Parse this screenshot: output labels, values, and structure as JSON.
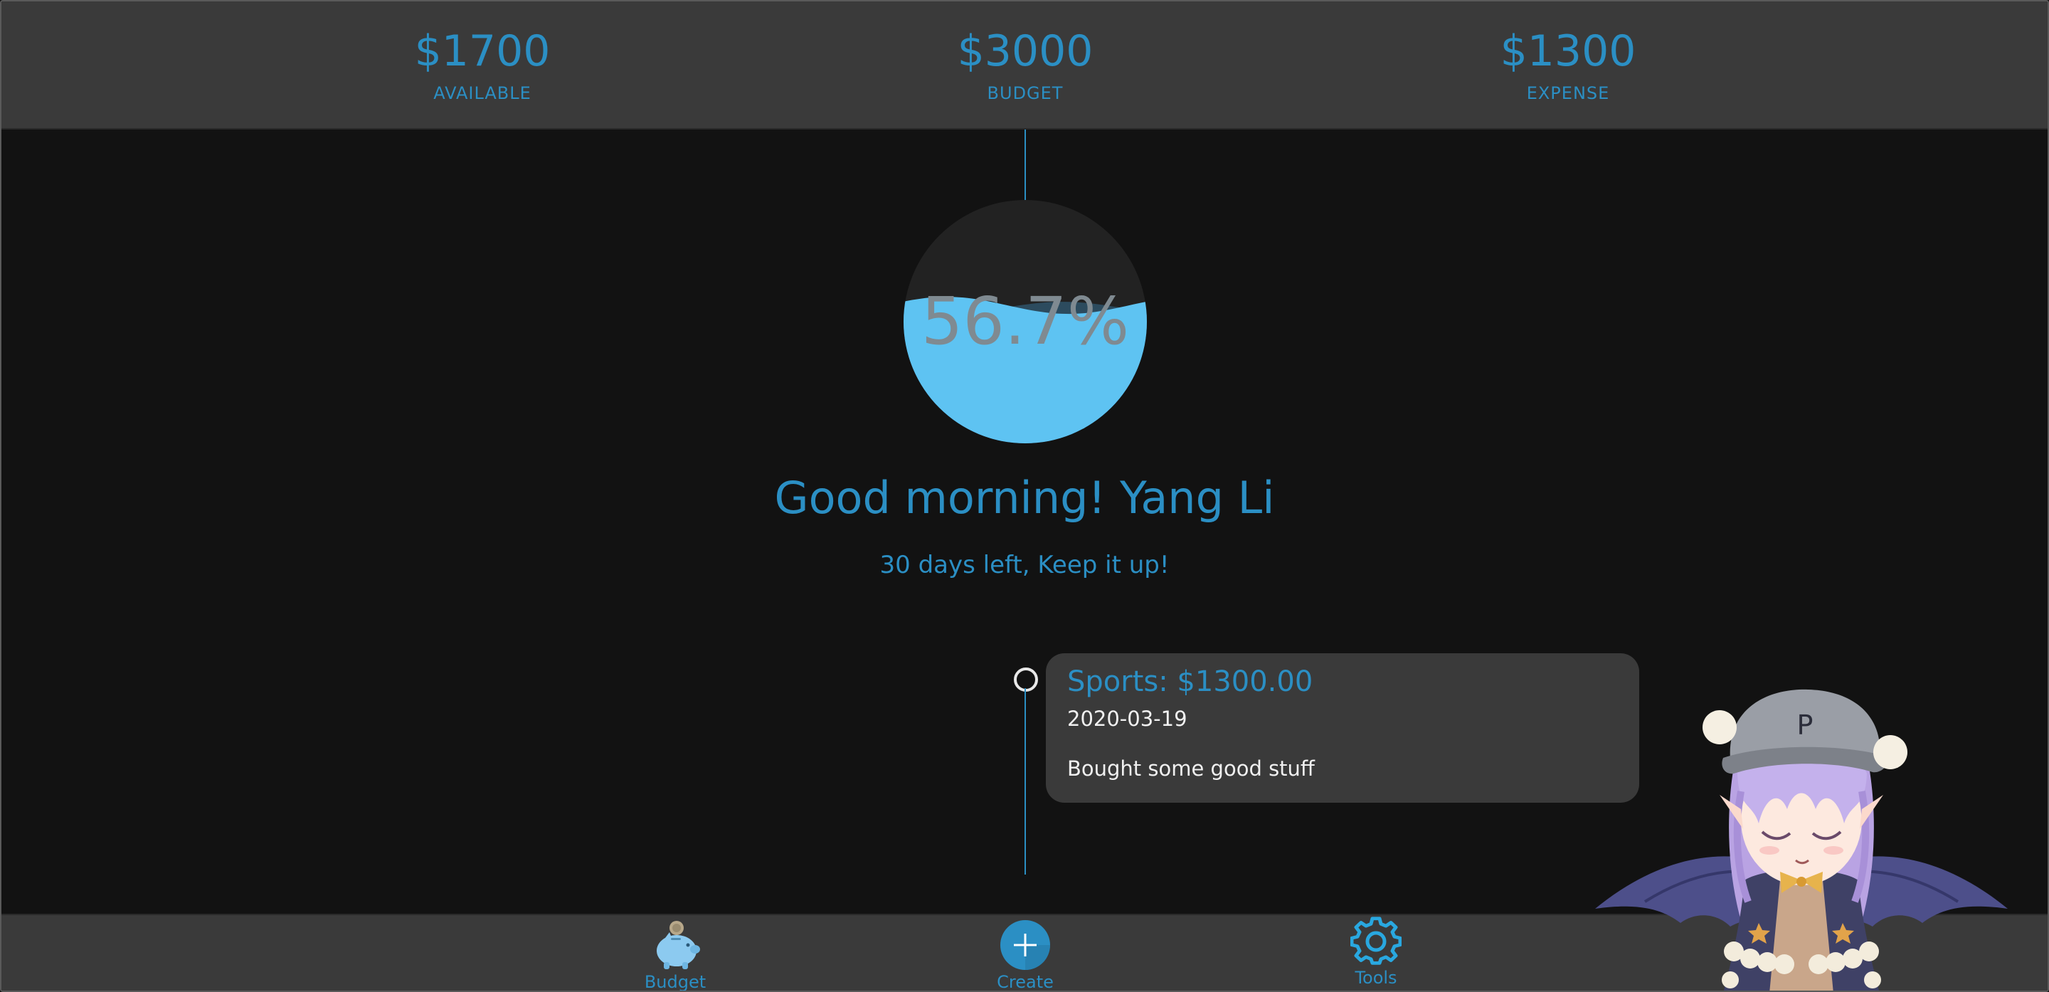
{
  "header": {
    "stats": [
      {
        "amount": "$1700",
        "label": "AVAILABLE"
      },
      {
        "amount": "$3000",
        "label": "BUDGET"
      },
      {
        "amount": "$1300",
        "label": "EXPENSE"
      }
    ]
  },
  "progress": {
    "percent_text": "56.7%",
    "fill_fraction": 0.567
  },
  "greeting": {
    "title": "Good morning! Yang Li",
    "subtitle": "30 days left, Keep it up!"
  },
  "timeline": {
    "entries": [
      {
        "title": "Sports: $1300.00",
        "date": "2020-03-19",
        "note": "Bought some good stuff"
      }
    ]
  },
  "nav": {
    "items": [
      {
        "label": "Budget",
        "icon": "piggy-bank-icon"
      },
      {
        "label": "Create",
        "icon": "plus-icon"
      },
      {
        "label": "Tools",
        "icon": "gear-icon"
      }
    ]
  },
  "colors": {
    "accent": "#2b8fc4",
    "water": "#5ec3f2",
    "background": "#121212",
    "panel": "#3a3a3a"
  }
}
